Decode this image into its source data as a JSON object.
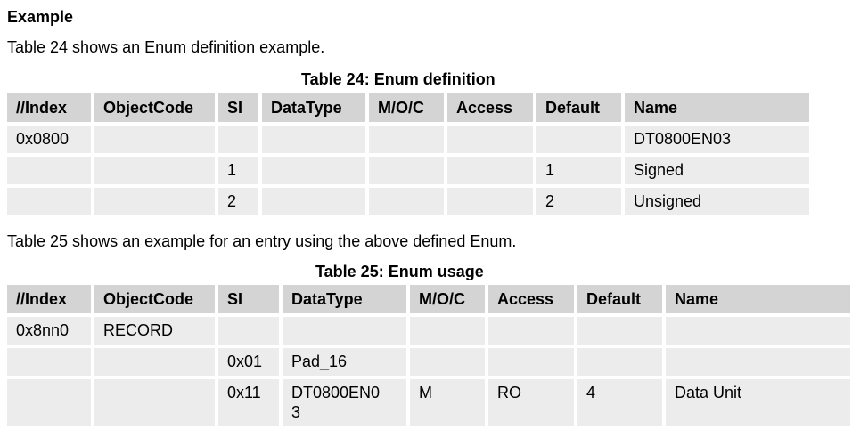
{
  "heading": "Example",
  "para1": "Table 24 shows an Enum definition example.",
  "table24": {
    "caption": "Table 24: Enum definition",
    "headers": [
      "//Index",
      "ObjectCode",
      "SI",
      "DataType",
      "M/O/C",
      "Access",
      "Default",
      "Name"
    ],
    "rows": [
      [
        "0x0800",
        "",
        "",
        "",
        "",
        "",
        "",
        "DT0800EN03"
      ],
      [
        "",
        "",
        "1",
        "",
        "",
        "",
        "1",
        "Signed"
      ],
      [
        "",
        "",
        "2",
        "",
        "",
        "",
        "2",
        "Unsigned"
      ]
    ]
  },
  "para2": "Table 25 shows an example for an entry using the above defined Enum.",
  "table25": {
    "caption": "Table 25: Enum usage",
    "headers": [
      "//Index",
      "ObjectCode",
      "SI",
      "DataType",
      "M/O/C",
      "Access",
      "Default",
      "Name"
    ],
    "rows": [
      [
        "0x8nn0",
        "RECORD",
        "",
        "",
        "",
        "",
        "",
        ""
      ],
      [
        "",
        "",
        "0x01",
        "Pad_16",
        "",
        "",
        "",
        ""
      ],
      [
        "",
        "",
        "0x11",
        "DT0800EN0\n3",
        "M",
        "RO",
        "4",
        "Data Unit"
      ]
    ]
  }
}
